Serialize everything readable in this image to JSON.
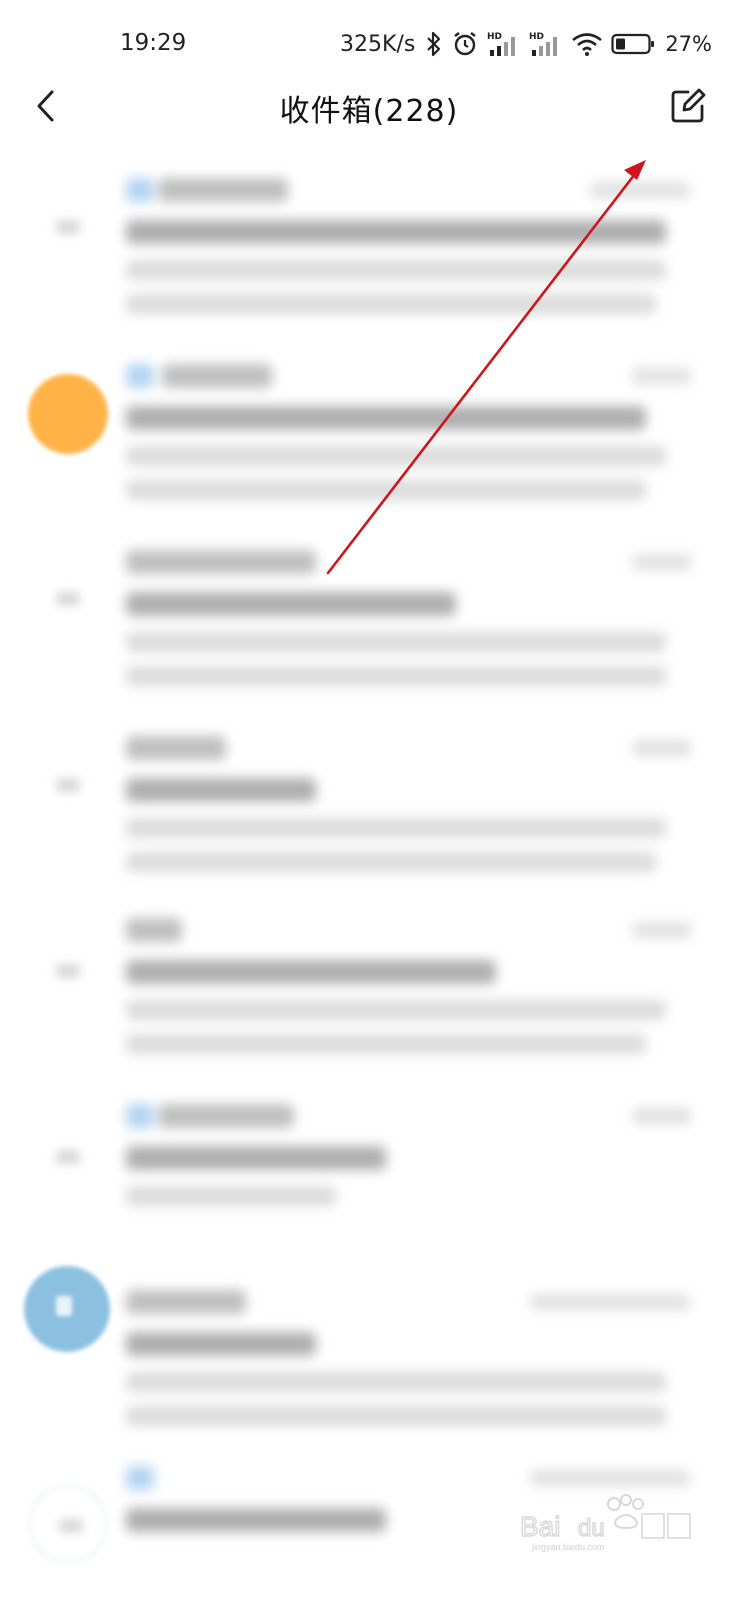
{
  "status_bar": {
    "time": "19:29",
    "net_speed": "325K/s",
    "battery_percent": "27%",
    "icons": [
      "bluetooth-icon",
      "alarm-icon",
      "signal-hd-1-icon",
      "signal-hd-2-icon",
      "wifi-icon",
      "battery-icon"
    ]
  },
  "header": {
    "title": "收件箱(228)",
    "back_icon": "chevron-left-icon",
    "compose_icon": "compose-edit-icon"
  },
  "mail_list": {
    "blurred": true,
    "items": [
      {
        "avatar": "plain",
        "has_tag": true
      },
      {
        "avatar": "orange",
        "has_tag": true
      },
      {
        "avatar": "plain",
        "has_tag": false
      },
      {
        "avatar": "plain",
        "has_tag": false
      },
      {
        "avatar": "plain",
        "has_tag": false
      },
      {
        "avatar": "plain",
        "has_tag": true
      },
      {
        "avatar": "blue",
        "has_tag": false
      },
      {
        "avatar": "plain",
        "has_tag": true
      }
    ]
  },
  "annotation": {
    "type": "arrow",
    "color": "#d0141a",
    "points_to": "compose-button"
  },
  "colors": {
    "accent_orange": "#ffb347",
    "accent_blue": "#8cc0e0",
    "arrow_red": "#d0141a"
  }
}
